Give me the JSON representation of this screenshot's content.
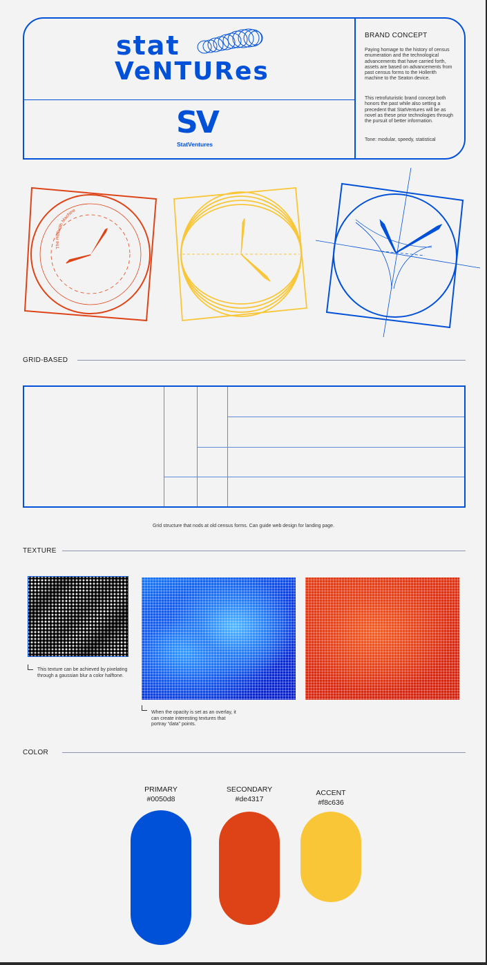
{
  "brand": {
    "word_top": "stat",
    "word_bottom": "VeNTURes",
    "monogram": "SV",
    "monogram_caption": "StatVentures"
  },
  "concept": {
    "title": "BRAND CONCEPT",
    "paragraph_1": "Paying homage to the history of census enumeration and the technological advancements that have carried forth, assets are based on advancements from past census forms to the Hollerith machine to the Seaton device.",
    "paragraph_2": "This retrofuturistic brand concept both honors the past while also setting a precedent that StatVentures will be as novel as these prior technologies through the pursuit of better information.",
    "tone": "Tone: modular, speedy, statistical"
  },
  "clocks": {
    "red_arc_text": "The Hollerith Machine"
  },
  "sections": {
    "grid": "GRID-BASED",
    "texture": "TEXTURE",
    "color": "COLOR"
  },
  "grid_caption": "Grid structure that nods at old census forms. Can guide web design for landing page.",
  "texture_captions": {
    "first": "This texture can be achieved by pixelating through a gaussian blur a color halftone.",
    "second": "When the opacity is set as an overlay, it can create interesting textures that portray “data” points."
  },
  "colors": {
    "primary": {
      "label": "PRIMARY",
      "hex_label": "#0050d8",
      "hex": "#0050d8"
    },
    "secondary": {
      "label": "SECONDARY",
      "hex_label": "#de4317",
      "hex": "#de4317"
    },
    "accent": {
      "label": "ACCENT",
      "hex_label": "#f8c636",
      "hex": "#f8c636"
    }
  },
  "icons": [
    "rings-coil-icon",
    "hollerith-clock-icon",
    "ellipse-clock-icon",
    "curve-clock-icon",
    "corner-arrow-icon"
  ]
}
